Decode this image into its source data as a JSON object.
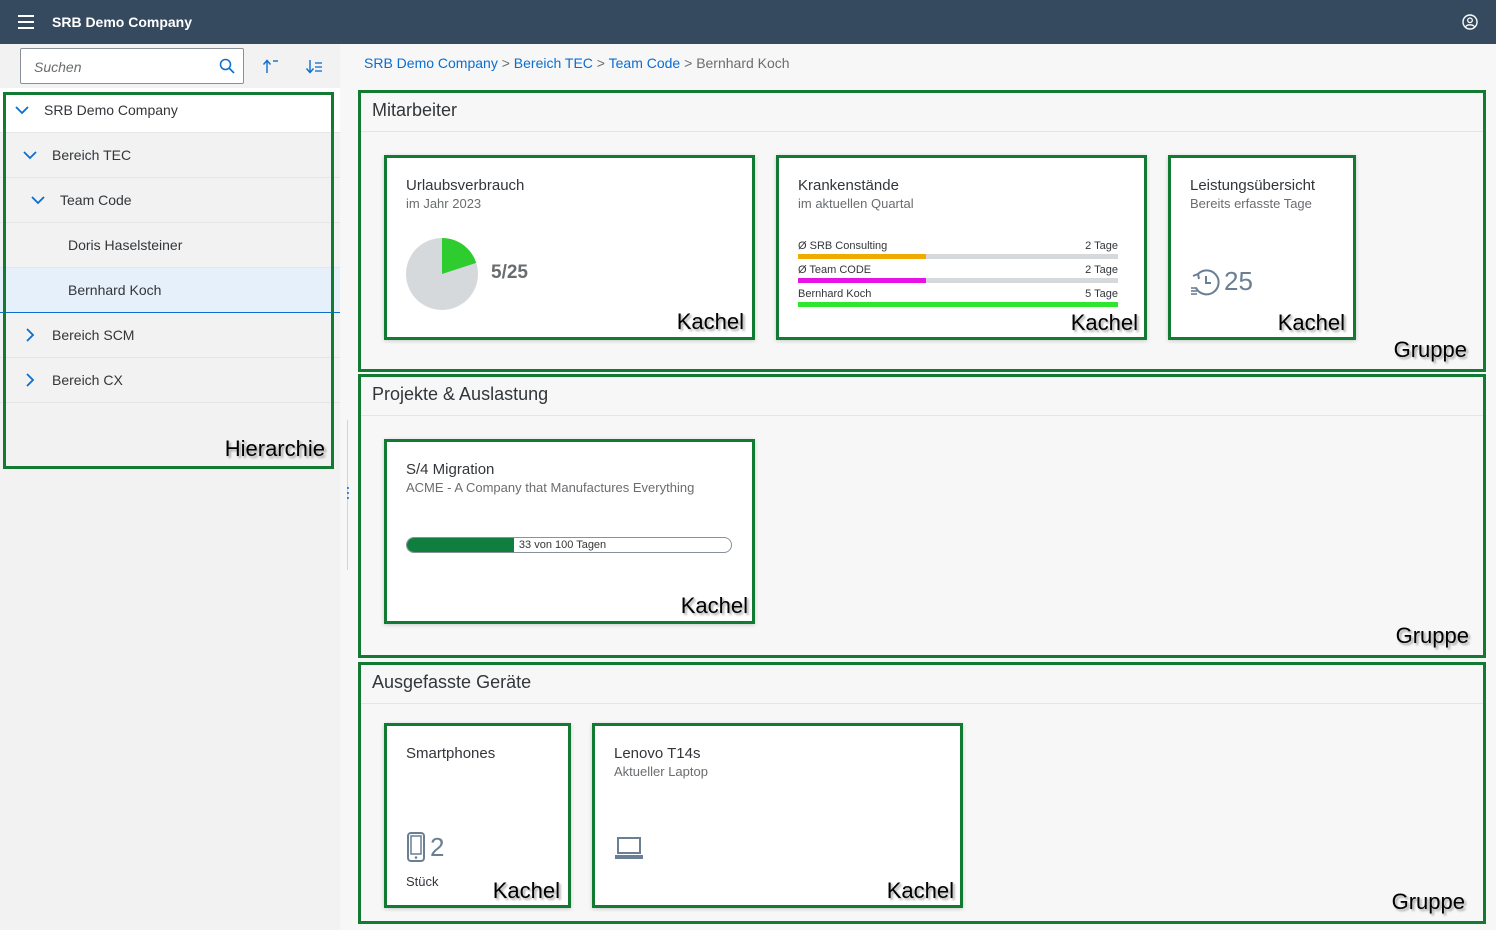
{
  "shell": {
    "title": "SRB Demo Company"
  },
  "search": {
    "placeholder": "Suchen"
  },
  "tree": [
    {
      "label": "SRB Demo Company",
      "expanded": true,
      "level": 0
    },
    {
      "label": "Bereich TEC",
      "expanded": true,
      "level": 1
    },
    {
      "label": "Team Code",
      "expanded": true,
      "level": 2
    },
    {
      "label": "Doris Haselsteiner",
      "level": 3
    },
    {
      "label": "Bernhard Koch",
      "level": 3,
      "selected": true
    },
    {
      "label": "Bereich SCM",
      "expanded": false,
      "level": 1
    },
    {
      "label": "Bereich CX",
      "expanded": false,
      "level": 1
    }
  ],
  "breadcrumb": {
    "links": [
      "SRB Demo Company",
      "Bereich TEC",
      "Team Code"
    ],
    "separator": ">",
    "current": "Bernhard Koch"
  },
  "annotations": {
    "tile": "Kachel",
    "group": "Gruppe",
    "hierarchy": "Hierarchie"
  },
  "groups": {
    "mitarbeiter": {
      "title": "Mitarbeiter",
      "vacation": {
        "title": "Urlaubsverbrauch",
        "subtitle": "im Jahr 2023",
        "value": "5/25",
        "used": 5,
        "total": 25
      },
      "sick": {
        "title": "Krankenstände",
        "subtitle": "im aktuellen Quartal",
        "rows": [
          {
            "label": "Ø SRB Consulting",
            "value": "2 Tage",
            "fraction": 0.4,
            "color": "#f0ab00"
          },
          {
            "label": "Ø Team CODE",
            "value": "2 Tage",
            "fraction": 0.4,
            "color": "#e612e6"
          },
          {
            "label": "Bernhard Koch",
            "value": "5 Tage",
            "fraction": 1.0,
            "color": "#2ee62e"
          }
        ]
      },
      "performance": {
        "title": "Leistungsübersicht",
        "subtitle": "Bereits erfasste Tage",
        "value": "25",
        "icon": "history-icon"
      }
    },
    "projekte": {
      "title": "Projekte & Auslastung",
      "migration": {
        "title": "S/4 Migration",
        "subtitle": "ACME - A Company that Manufactures Everything",
        "progress_text": "33 von 100 Tagen",
        "progress_fraction": 0.33
      }
    },
    "geraete": {
      "title": "Ausgefasste Geräte",
      "smartphones": {
        "title": "Smartphones",
        "value": "2",
        "unit": "Stück",
        "icon": "smartphone-icon"
      },
      "laptop": {
        "title": "Lenovo T14s",
        "subtitle": "Aktueller Laptop",
        "icon": "laptop-icon"
      }
    }
  },
  "colors": {
    "shell": "#354a5f",
    "link": "#0a6ed1",
    "frame": "#137a34",
    "pie_fill": "#2ecc2e",
    "pie_bg": "#d5d9dc",
    "progress": "#107e3e"
  }
}
